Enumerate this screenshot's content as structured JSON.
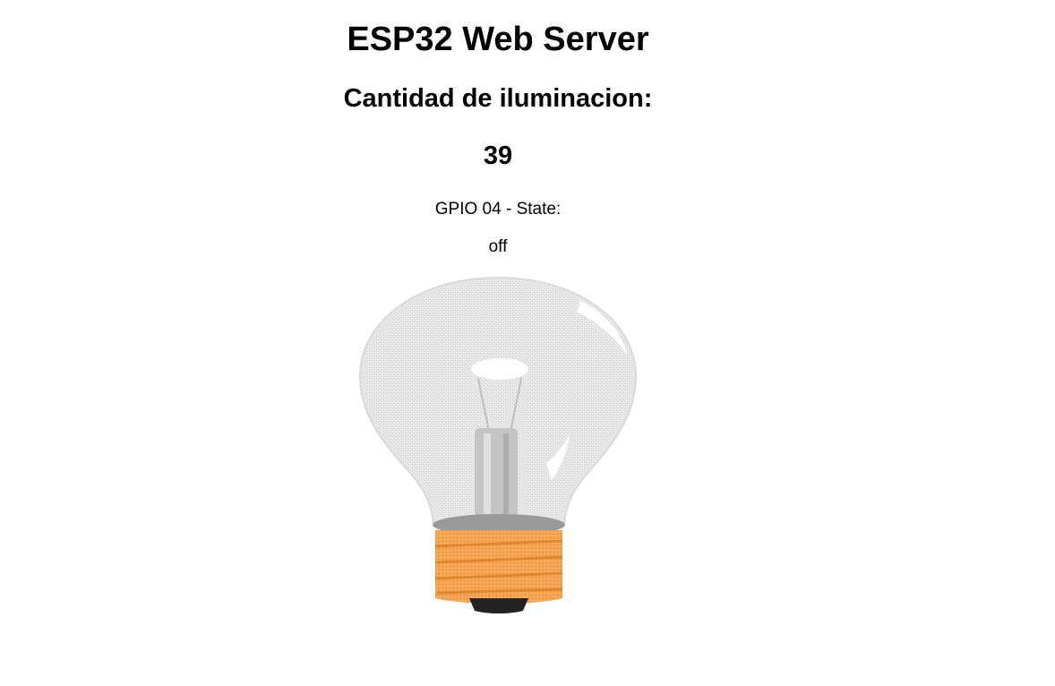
{
  "page": {
    "title": "ESP32 Web Server",
    "subtitle": "Cantidad de iluminacion:",
    "illumination_value": "39",
    "gpio_label": "GPIO 04 - State:",
    "gpio_state": "off"
  },
  "bulb": {
    "icon": "lightbulb-off-icon",
    "glass_color": "#e3e3e3",
    "base_color": "#f7a04a",
    "tip_color": "#222222"
  }
}
